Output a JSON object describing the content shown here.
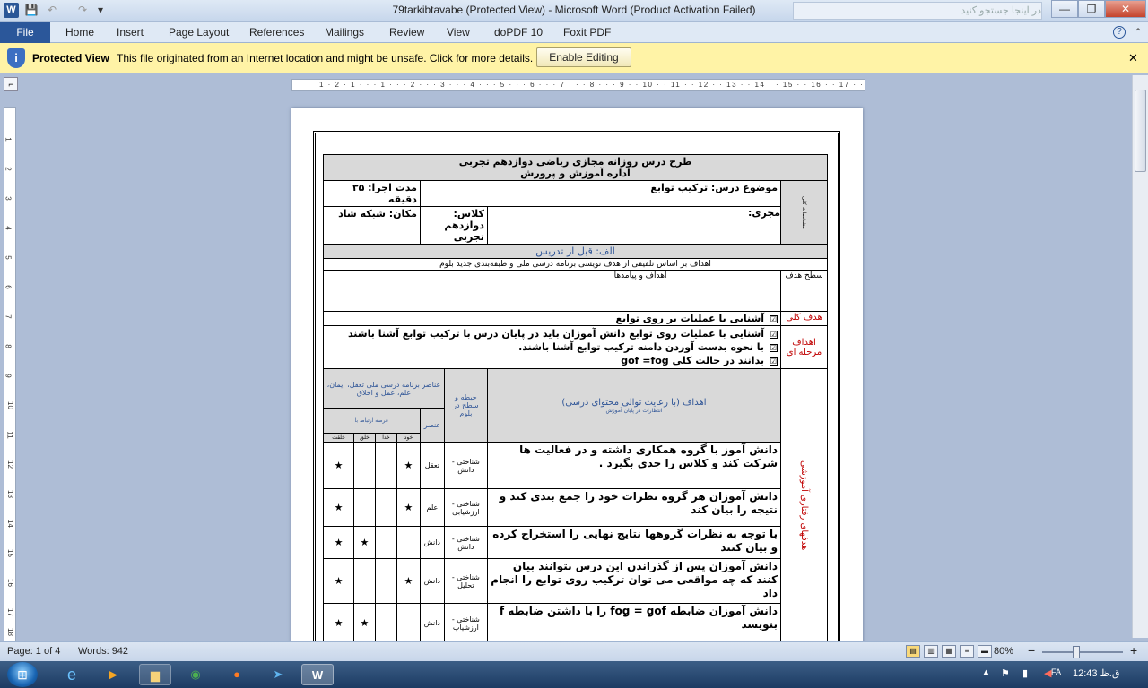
{
  "window": {
    "title": "79tarkibtavabe (Protected View)  -  Microsoft Word (Product Activation Failed)",
    "search_placeholder": "در اینجا جستجو کنید",
    "minimize": "—",
    "maximize": "❐",
    "close": "✕"
  },
  "quick_access": {
    "logo": "W",
    "save": "💾",
    "undo": "↶",
    "redo": "↷",
    "customize": "▾"
  },
  "ribbon": {
    "file": "File",
    "tabs": [
      "Home",
      "Insert",
      "Page Layout",
      "References",
      "Mailings",
      "Review",
      "View",
      "doPDF 10",
      "Foxit PDF"
    ],
    "help": "?",
    "collapse": "⌃"
  },
  "protected_view": {
    "label": "Protected View",
    "message": "This file originated from an Internet location and might be unsafe. Click for more details.",
    "button": "Enable Editing",
    "close": "✕",
    "icon": "shield-info-icon"
  },
  "ruler": {
    "marks": "1 · 2 · 1 · · · 1 · · · 2 · · · 3 · · · 4 · · · 5 · · · 6 · · · 7 · · · 8 · · · 9 · · 10 · · 11 · · 12 · · 13 · · 14 · · 15 · · 16 · · 17 · · 18 · · ·",
    "vertical": [
      "1",
      "2",
      "3",
      "4",
      "5",
      "6",
      "7",
      "8",
      "9",
      "10",
      "11",
      "12",
      "13",
      "14",
      "15",
      "16",
      "17",
      "18"
    ]
  },
  "doc": {
    "header_line1": "طرح درس روزانه مجازی ریاضی دوازدهم تجربی",
    "header_line2": "اداره آموزش و پرورش",
    "side_label": "مشخصات کلی",
    "subject": "موضوع درس: ترکیب توابع",
    "duration": "مدت اجرا:  ۳۵ دقیقه",
    "teacher": "مجری:",
    "class": "کلاس: دوازدهم تجربی",
    "place": "مکان: شبکه شاد",
    "section_a": "الف: قبل از تدریس",
    "goals_basis": "اهداف بر اساس تلفیقی از هدف نویسی برنامه درسی ملی و طبقه‌بندی جدید بلوم",
    "level_label": "سطح هدف",
    "goals_outcomes": "اهداف و پیامدها",
    "general_goal_label": "هدف کلی",
    "general_goal": "آشنایی با عملیات بر روی توابع",
    "stage_goals_label": "اهداف مرحله ای",
    "stage_goals": [
      "آشنایی با عملیات روی توابع دانش آموزان باید در پایان درس با ترکیب توابع آشنا باشند",
      "با نحوه بدست آوردن دامنه ترکیب توابع آشنا باشند.",
      "بدانند در حالت کلی gof =fog"
    ],
    "check": "☑",
    "behavior_label": "هدفهای رفتاری آموزشی",
    "goals_col": "اهداف (با رعایت توالی محتوای درسی)",
    "goals_col_sub": "انتظارات در پایان آموزش",
    "domain_col": "حیطه و سطح در بلوم",
    "elements_col": "عناصر برنامه درسی ملی تعقل، ایمان، علم، عمل و اخلاق",
    "element_col": "عنصر",
    "realm_col": "عرصه ارتباط با",
    "realm_sub": [
      "خود",
      "خدا",
      "خلق",
      "خلقت"
    ],
    "rows": [
      {
        "goal": "دانش آموز با گروه همکاری داشته و در فعالیت ها شرکت کند و کلاس را جدی بگیرد .",
        "domain": "شناختی - دانش",
        "element": "تعقل",
        "marks": [
          "★",
          "",
          "",
          "★"
        ]
      },
      {
        "goal": "دانش آموزان هر گروه نظرات خود را جمع بندی کند و نتیجه را بیان کند",
        "domain": "شناختی - ارزشیابی",
        "element": "علم",
        "marks": [
          "★",
          "",
          "",
          "★"
        ]
      },
      {
        "goal": "با توجه به نظرات گروهها نتایج نهایی را استخراج کرده و بیان کنند",
        "domain": "شناختی - دانش",
        "element": "دانش",
        "marks": [
          "",
          "",
          "★",
          "★"
        ]
      },
      {
        "goal": "دانش آموزان پس از گذراندن این درس بتوانند بیان کنند که چه مواقعی می توان ترکیب روی توابع را انجام داد",
        "domain": "شناختی - تحلیل",
        "element": "دانش",
        "marks": [
          "★",
          "",
          "",
          "★"
        ]
      },
      {
        "goal": "دانش آموزان ضابطه fog = gof را با داشتن ضابطه f بنویسد",
        "domain": "شناختی - ارزشیاب",
        "element": "دانش",
        "marks": [
          "",
          "",
          "★",
          "★"
        ]
      }
    ]
  },
  "status": {
    "page": "Page: 1 of 4",
    "words": "Words: 942",
    "zoom": "80%",
    "zoom_out": "−",
    "zoom_in": "+"
  },
  "taskbar": {
    "apps": [
      "ie-icon",
      "media-player-icon",
      "explorer-icon",
      "chrome-icon",
      "firefox-icon",
      "telegram-icon",
      "word-icon"
    ],
    "lang": "FA",
    "clock": "12:43 ق.ظ"
  }
}
